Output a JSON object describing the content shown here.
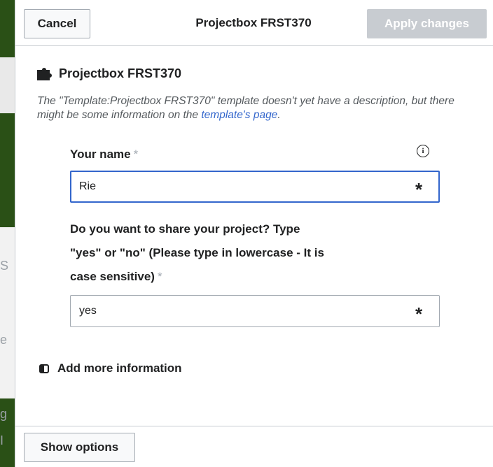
{
  "background": {
    "letters": [
      "S",
      "e",
      "g",
      "I"
    ]
  },
  "dialog": {
    "title": "Projectbox FRST370",
    "cancel_label": "Cancel",
    "apply_label": "Apply changes",
    "show_options_label": "Show options"
  },
  "template": {
    "icon": "puzzle-icon",
    "name": "Projectbox FRST370",
    "description_prefix": "The \"Template:Projectbox FRST370\" template doesn't yet have a description, but there might be some information on the ",
    "description_link": "template's page",
    "description_suffix": "."
  },
  "fields": {
    "name": {
      "label": "Your name",
      "required_mark": "*",
      "value": "Rie",
      "icon": "info-icon",
      "info_glyph": "i",
      "trailing_mark": "*"
    },
    "share": {
      "label_line1": "Do you want to share your project? Type",
      "label_line2": "\"yes\" or \"no\" (Please type in lowercase - It is",
      "label_line3": "case sensitive)",
      "required_mark": "*",
      "value": "yes",
      "trailing_mark": "*"
    }
  },
  "add_more": {
    "icon": "toggle-icon",
    "label": "Add more information"
  },
  "colors": {
    "backdrop": "#2a5016",
    "link": "#3366cc",
    "focus_border": "#3366cc",
    "apply_disabled": "#c8ccd1"
  }
}
